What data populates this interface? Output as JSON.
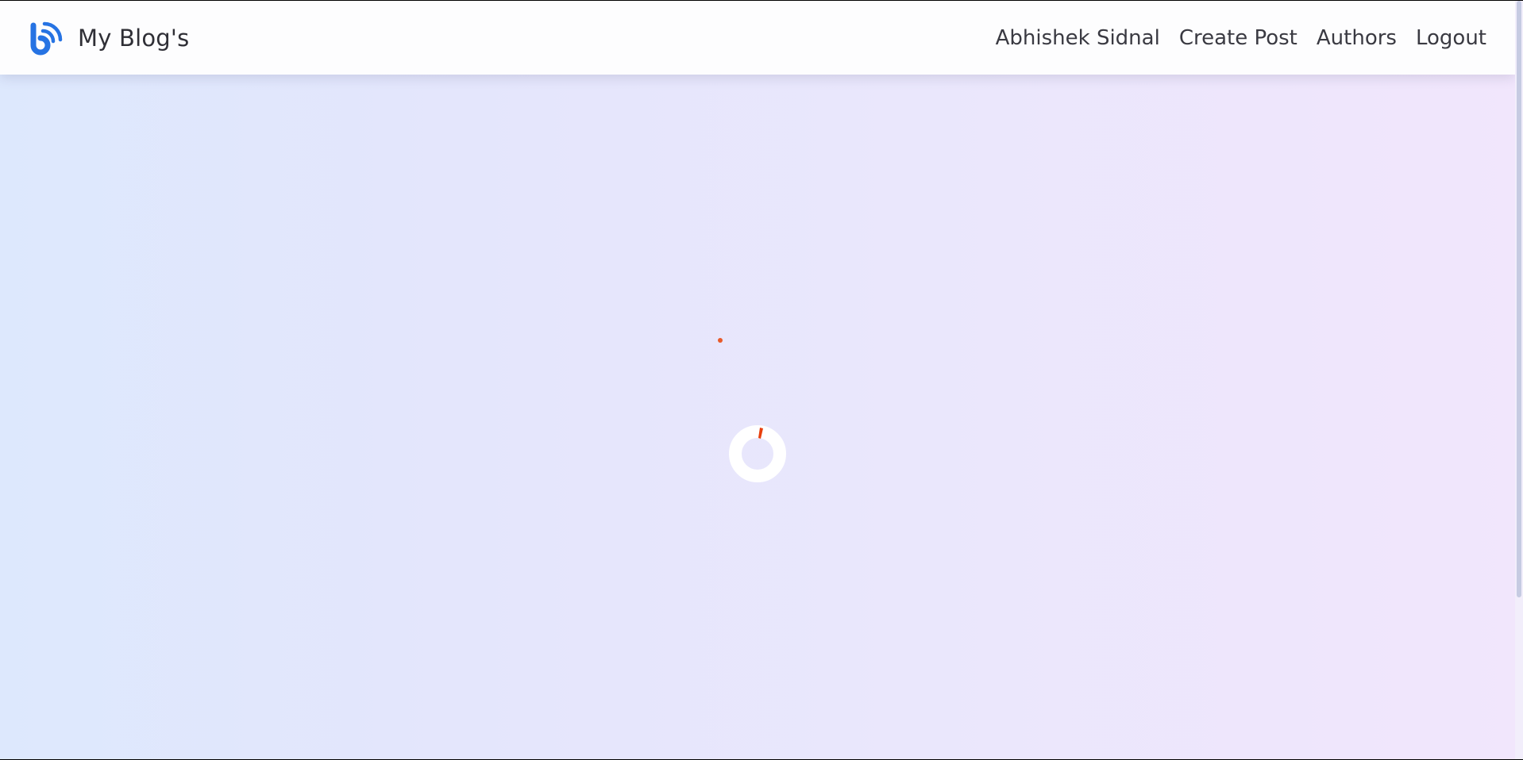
{
  "navbar": {
    "brand": {
      "logo_icon": "rss-b-logo-icon",
      "title": "My Blog's"
    },
    "links": [
      {
        "label": "Abhishek Sidnal"
      },
      {
        "label": "Create Post"
      },
      {
        "label": "Authors"
      },
      {
        "label": "Logout"
      }
    ]
  },
  "loading": {
    "spinner_icon": "loading-spinner-icon"
  },
  "colors": {
    "brand_blue": "#2673e3",
    "spinner_accent": "#e8400e",
    "navbar_bg": "#fdfdfe",
    "gradient_start": "#dde8fd",
    "gradient_end": "#f1e6fc"
  }
}
